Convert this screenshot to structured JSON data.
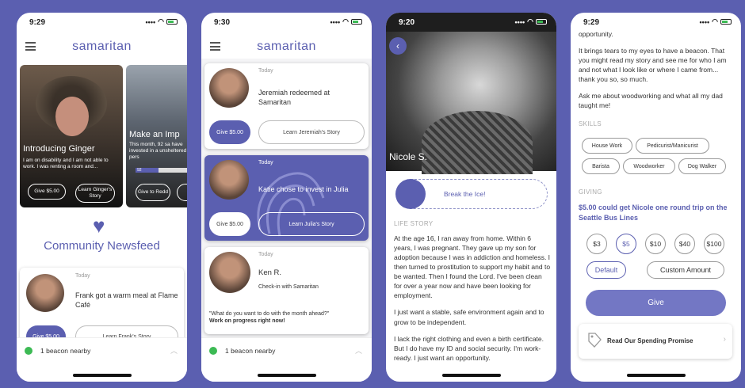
{
  "colors": {
    "accent": "#5b5fb0",
    "background": "#5b5fb0",
    "beacon_dot": "#3cba54"
  },
  "phone1": {
    "time": "9:29",
    "brand": "samaritan",
    "card1": {
      "title": "Introducing Ginger",
      "desc": "I am on disability and I am not able to work.  I was renting a room and...",
      "give": "Give $5.00",
      "story": "Learn Ginger's Story"
    },
    "card2": {
      "title": "Make an Imp",
      "desc": "This month, 92 sa have invested in a unsheltered pers",
      "progress": "92",
      "progress_fraction": 0.45,
      "give": "Give to Redd"
    },
    "feed_title": "Community Newsfeed",
    "feed": {
      "date": "Today",
      "text": "Frank got a warm meal at Flame Café",
      "give": "Give $5.00",
      "story": "Learn Frank's Story"
    },
    "beacon": "1 beacon nearby"
  },
  "phone2": {
    "time": "9:30",
    "brand": "samaritan",
    "items": [
      {
        "date": "Today",
        "text": "Jeremiah redeemed at Samaritan",
        "give": "Give $5.00",
        "story": "Learn Jeremiah's Story"
      },
      {
        "date": "Today",
        "text": "Katie chose to invest in Julia",
        "give": "Give $5.00",
        "story": "Learn Julia's Story"
      },
      {
        "date": "Today",
        "name": "Ken R.",
        "sub": "Check-in with Samaritan",
        "question": "\"What do you want to do with the month ahead?\"",
        "answer": "Work on progress right now!"
      }
    ],
    "beacon": "1 beacon nearby"
  },
  "phone3": {
    "time": "9:20",
    "name": "Nicole S.",
    "ice": "Break the Ice!",
    "section": "LIFE STORY",
    "story": [
      "At the age 16, I ran away from home. Within 6 years, I was pregnant. They gave up my son for adoption because I was in addiction and homeless. I then turned to prostitution to support my habit and to be wanted. Then I found the Lord. I've been clean for over a year now and have been looking for employment.",
      "I just want a stable, safe environment again and to grow to be independent.",
      "I lack the right clothing and even a birth certificate. But I do have my ID and social security. I'm work-ready. I just want an opportunity."
    ]
  },
  "phone4": {
    "time": "9:29",
    "top": "opportunity.",
    "para1": "It brings tears to my eyes to have a beacon. That you might read my story and see me for who I am and not what I look like or where I came from... thank you so, so much.",
    "para2": "Ask me about woodworking and what all my dad taught me!",
    "skills_label": "SKILLS",
    "skills": [
      "House Work",
      "Pedicurist/Manicurist",
      "Barista",
      "Woodworker",
      "Dog Walker"
    ],
    "giving_label": "GIVING",
    "giving_text": "$5.00 could get Nicole one round trip on the Seattle Bus Lines",
    "amounts": [
      "$3",
      "$5",
      "$10",
      "$40",
      "$100"
    ],
    "default": "Default",
    "custom": "Custom Amount",
    "give": "Give",
    "promise": "Read Our Spending Promise"
  }
}
